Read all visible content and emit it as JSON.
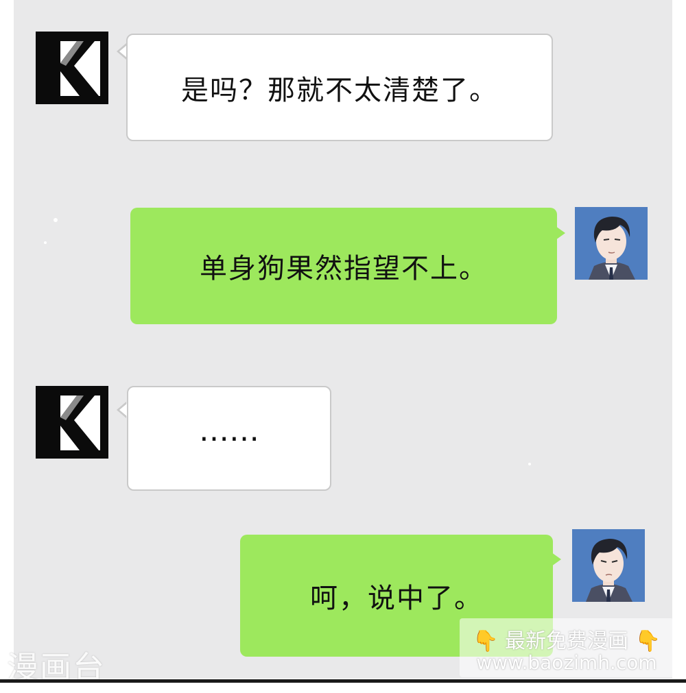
{
  "messages": [
    {
      "side": "left",
      "avatar": "k-logo-icon",
      "text": "是吗？那就不太清楚了。"
    },
    {
      "side": "right",
      "avatar": "man-avatar",
      "text": "单身狗果然指望不上。"
    },
    {
      "side": "left",
      "avatar": "k-logo-icon",
      "text": "……"
    },
    {
      "side": "right",
      "avatar": "man-avatar",
      "text": "呵，说中了。"
    }
  ],
  "avatars": {
    "k_letter": "K"
  },
  "watermarks": {
    "left_text": "漫画台",
    "promo_text": "最新免费漫画",
    "promo_icon": "pointing-hand-icon",
    "url": "www.baozimh.com"
  },
  "colors": {
    "chat_background": "#e9e9ea",
    "green_bubble": "#9de85d",
    "white_bubble": "#ffffff",
    "avatar_blue": "#4f7ec0"
  }
}
